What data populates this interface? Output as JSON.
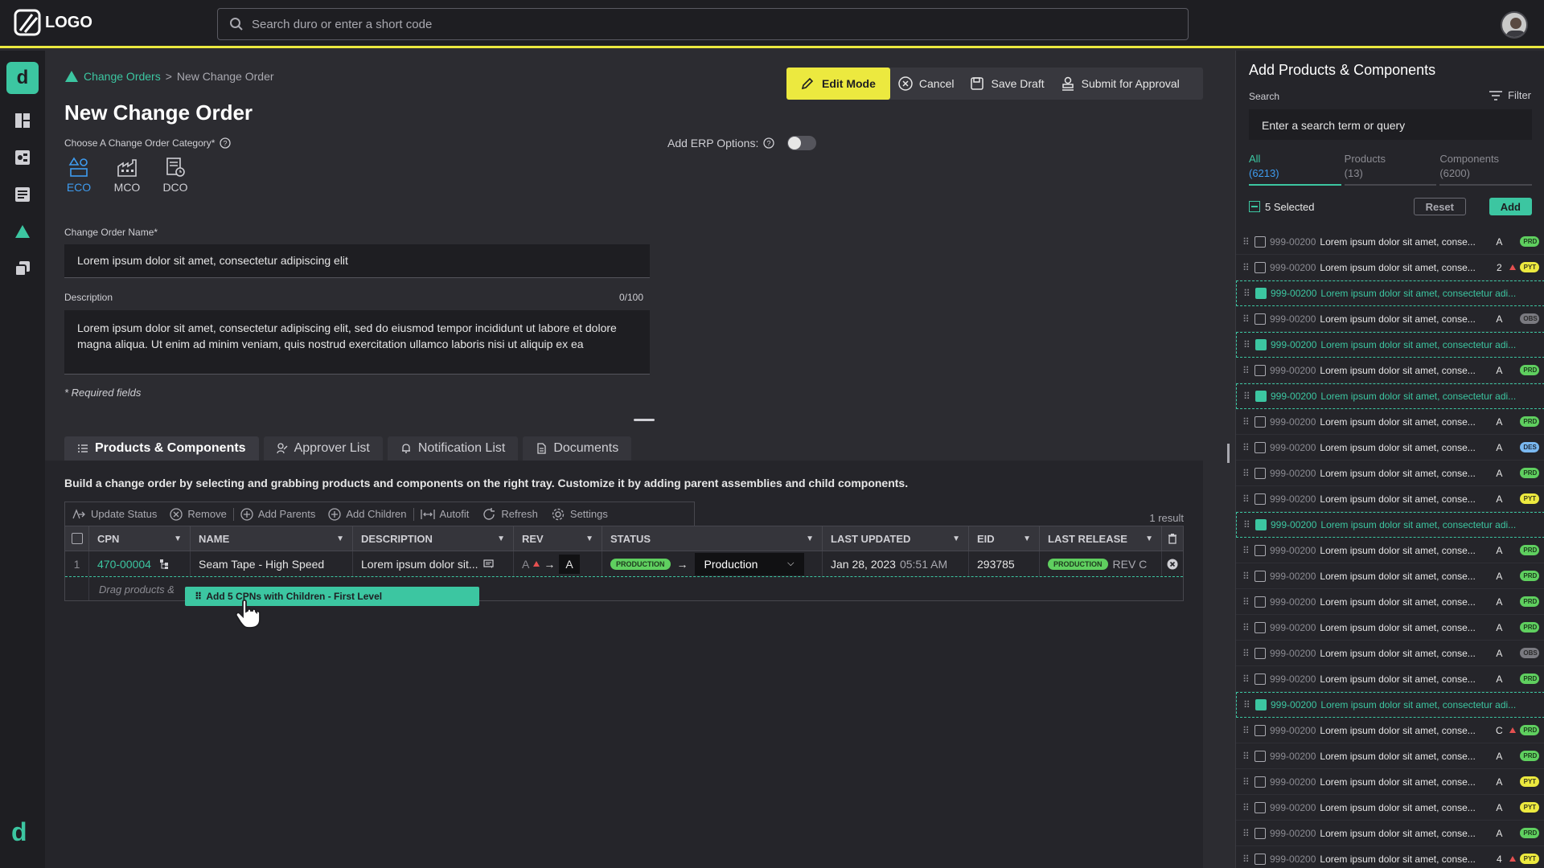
{
  "topbar": {
    "logo_text": "LOGO",
    "search_placeholder": "Search duro or enter a short code"
  },
  "sidebar": {
    "items": [
      "dashboard-icon",
      "components-icon",
      "products-icon",
      "change-orders-icon",
      "releases-icon"
    ],
    "bottom_logo": "d"
  },
  "breadcrumb": {
    "parent": "Change Orders",
    "separator": ">",
    "current": "New Change Order"
  },
  "page_title": "New Change Order",
  "actions": {
    "edit_mode": "Edit Mode",
    "cancel": "Cancel",
    "save_draft": "Save Draft",
    "submit": "Submit for Approval"
  },
  "category": {
    "label": "Choose A Change Order Category*",
    "options": [
      "ECO",
      "MCO",
      "DCO"
    ],
    "selected": "ECO"
  },
  "erp": {
    "label": "Add ERP Options:"
  },
  "form": {
    "name_label": "Change Order Name*",
    "name_value": "Lorem ipsum dolor sit amet, consectetur adipiscing elit",
    "desc_label": "Description",
    "desc_count": "0/100",
    "desc_line1": "Lorem ipsum dolor sit amet, consectetur adipiscing elit, sed do eiusmod tempor incididunt ut labore et dolore",
    "desc_line2": "magna aliqua. Ut enim ad minim veniam, quis nostrud exercitation ullamco laboris nisi ut aliquip ex ea",
    "required_note": "* Required fields"
  },
  "tabs": [
    "Products & Components",
    "Approver List",
    "Notification List",
    "Documents"
  ],
  "panel": {
    "description": "Build a change order by selecting and grabbing products and components on the right tray. Customize it by adding parent assemblies and child components.",
    "toolbar": [
      "Update Status",
      "Remove",
      "Add Parents",
      "Add Children",
      "Autofit",
      "Refresh",
      "Settings"
    ],
    "result_count": "1 result",
    "columns": [
      "CPN",
      "NAME",
      "DESCRIPTION",
      "REV",
      "STATUS",
      "LAST UPDATED",
      "EID",
      "LAST RELEASE"
    ],
    "row": {
      "index": "1",
      "cpn": "470-00004",
      "name": "Seam Tape - High Speed",
      "description": "Lorem ipsum dolor sit...",
      "rev_from": "A",
      "rev_to": "A",
      "status_badge": "PRODUCTION",
      "status_select": "Production",
      "updated_date": "Jan 28, 2023",
      "updated_time": "05:51 AM",
      "eid": "293785",
      "last_release_badge": "PRODUCTION",
      "last_release_rev": "REV C"
    },
    "drop_hint": "Drag products &",
    "drag_pill": "Add 5 CPNs with Children - First Level"
  },
  "right_panel": {
    "title": "Add Products & Components",
    "search_label": "Search",
    "filter": "Filter",
    "search_placeholder": "Enter a search term or query",
    "tabs": [
      {
        "label": "All",
        "count": "(6213)"
      },
      {
        "label": "Products",
        "count": "(13)"
      },
      {
        "label": "Components",
        "count": "(6200)"
      }
    ],
    "selected_text": "5 Selected",
    "reset": "Reset",
    "add": "Add",
    "items": [
      {
        "cpn": "999-00200",
        "name": "Lorem ipsum dolor sit amet, conse...",
        "rev": "A",
        "status": "PRD",
        "sel": false,
        "warn": false
      },
      {
        "cpn": "999-00200",
        "name": "Lorem ipsum dolor sit amet, conse...",
        "rev": "2",
        "status": "PYT",
        "sel": false,
        "warn": true
      },
      {
        "cpn": "999-00200",
        "name": "Lorem ipsum dolor sit amet, consectetur adi...",
        "rev": "",
        "status": "",
        "sel": true,
        "warn": false
      },
      {
        "cpn": "999-00200",
        "name": "Lorem ipsum dolor sit amet, conse...",
        "rev": "A",
        "status": "OBS",
        "sel": false,
        "warn": false
      },
      {
        "cpn": "999-00200",
        "name": "Lorem ipsum dolor sit amet, consectetur adi...",
        "rev": "",
        "status": "",
        "sel": true,
        "warn": false
      },
      {
        "cpn": "999-00200",
        "name": "Lorem ipsum dolor sit amet, conse...",
        "rev": "A",
        "status": "PRD",
        "sel": false,
        "warn": false
      },
      {
        "cpn": "999-00200",
        "name": "Lorem ipsum dolor sit amet, consectetur adi...",
        "rev": "",
        "status": "",
        "sel": true,
        "warn": false
      },
      {
        "cpn": "999-00200",
        "name": "Lorem ipsum dolor sit amet, conse...",
        "rev": "A",
        "status": "PRD",
        "sel": false,
        "warn": false
      },
      {
        "cpn": "999-00200",
        "name": "Lorem ipsum dolor sit amet, conse...",
        "rev": "A",
        "status": "DES",
        "sel": false,
        "warn": false
      },
      {
        "cpn": "999-00200",
        "name": "Lorem ipsum dolor sit amet, conse...",
        "rev": "A",
        "status": "PRD",
        "sel": false,
        "warn": false
      },
      {
        "cpn": "999-00200",
        "name": "Lorem ipsum dolor sit amet, conse...",
        "rev": "A",
        "status": "PYT",
        "sel": false,
        "warn": false
      },
      {
        "cpn": "999-00200",
        "name": "Lorem ipsum dolor sit amet, consectetur adi...",
        "rev": "",
        "status": "",
        "sel": true,
        "warn": false
      },
      {
        "cpn": "999-00200",
        "name": "Lorem ipsum dolor sit amet, conse...",
        "rev": "A",
        "status": "PRD",
        "sel": false,
        "warn": false
      },
      {
        "cpn": "999-00200",
        "name": "Lorem ipsum dolor sit amet, conse...",
        "rev": "A",
        "status": "PRD",
        "sel": false,
        "warn": false
      },
      {
        "cpn": "999-00200",
        "name": "Lorem ipsum dolor sit amet, conse...",
        "rev": "A",
        "status": "PRD",
        "sel": false,
        "warn": false
      },
      {
        "cpn": "999-00200",
        "name": "Lorem ipsum dolor sit amet, conse...",
        "rev": "A",
        "status": "PRD",
        "sel": false,
        "warn": false
      },
      {
        "cpn": "999-00200",
        "name": "Lorem ipsum dolor sit amet, conse...",
        "rev": "A",
        "status": "OBS",
        "sel": false,
        "warn": false
      },
      {
        "cpn": "999-00200",
        "name": "Lorem ipsum dolor sit amet, conse...",
        "rev": "A",
        "status": "PRD",
        "sel": false,
        "warn": false
      },
      {
        "cpn": "999-00200",
        "name": "Lorem ipsum dolor sit amet, consectetur adi...",
        "rev": "",
        "status": "",
        "sel": true,
        "warn": false
      },
      {
        "cpn": "999-00200",
        "name": "Lorem ipsum dolor sit amet, conse...",
        "rev": "C",
        "status": "PRD",
        "sel": false,
        "warn": true
      },
      {
        "cpn": "999-00200",
        "name": "Lorem ipsum dolor sit amet, conse...",
        "rev": "A",
        "status": "PRD",
        "sel": false,
        "warn": false
      },
      {
        "cpn": "999-00200",
        "name": "Lorem ipsum dolor sit amet, conse...",
        "rev": "A",
        "status": "PYT",
        "sel": false,
        "warn": false
      },
      {
        "cpn": "999-00200",
        "name": "Lorem ipsum dolor sit amet, conse...",
        "rev": "A",
        "status": "PYT",
        "sel": false,
        "warn": false
      },
      {
        "cpn": "999-00200",
        "name": "Lorem ipsum dolor sit amet, conse...",
        "rev": "A",
        "status": "PRD",
        "sel": false,
        "warn": false
      },
      {
        "cpn": "999-00200",
        "name": "Lorem ipsum dolor sit amet, conse...",
        "rev": "4",
        "status": "PYT",
        "sel": false,
        "warn": true
      }
    ]
  },
  "colors": {
    "accent": "#3cc6a1",
    "edit_yellow": "#ece93f",
    "selected_blue": "#3e9cf0",
    "production_green": "#5fcf5f"
  }
}
